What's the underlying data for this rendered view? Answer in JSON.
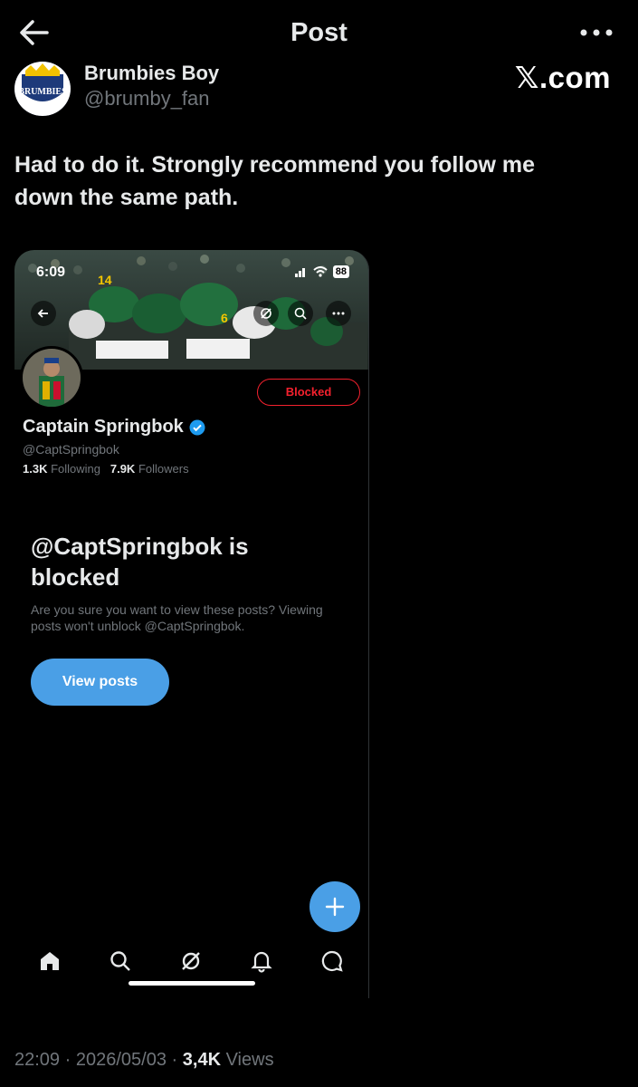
{
  "header": {
    "title": "Post",
    "back_icon": "arrow-left-icon",
    "more_icon": "more-horizontal-icon"
  },
  "author": {
    "name": "Brumbies Boy",
    "handle": "@brumby_fan",
    "avatar_text": "BRUMBIES"
  },
  "watermark": "𝕏.com",
  "post": {
    "text": "Had to do it. Strongly recommend you follow me down the same path."
  },
  "screenshot": {
    "status_time": "6:09",
    "battery": "88",
    "blocked_label": "Blocked",
    "profile": {
      "name": "Captain Springbok",
      "handle": "@CaptSpringbok",
      "following_count": "1.3K",
      "following_label": "Following",
      "followers_count": "7.9K",
      "followers_label": "Followers"
    },
    "blocked_title": "@CaptSpringbok is blocked",
    "blocked_subtitle": "Are you sure you want to view these posts? Viewing posts won't unblock @CaptSpringbok.",
    "view_posts_label": "View posts",
    "tabs": [
      "home-icon",
      "search-icon",
      "grok-icon",
      "bell-icon",
      "messages-icon"
    ],
    "accent": "#4a9fe6",
    "blocked_color": "#f4212e"
  },
  "footer": {
    "time": "22:09",
    "date": "2026/05/03",
    "views_count": "3,4K",
    "views_label": "Views",
    "separator": "·"
  }
}
